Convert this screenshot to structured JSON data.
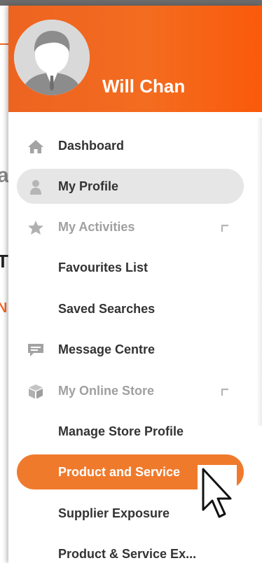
{
  "background_fragments": {
    "a": "a",
    "t": "T",
    "n": "N"
  },
  "user": {
    "name": "Will Chan"
  },
  "menu": {
    "items": [
      {
        "label": "Dashboard",
        "icon": "home-icon"
      },
      {
        "label": "My Profile",
        "icon": "person-icon"
      },
      {
        "label": "My Activities",
        "icon": "star-icon"
      },
      {
        "label": "Favourites List"
      },
      {
        "label": "Saved Searches"
      },
      {
        "label": "Message Centre",
        "icon": "message-icon"
      },
      {
        "label": "My Online Store",
        "icon": "box-icon"
      },
      {
        "label": "Manage Store Profile"
      },
      {
        "label": "Product and Service"
      },
      {
        "label": "Supplier Exposure"
      },
      {
        "label": "Product & Service Ex..."
      }
    ]
  },
  "colors": {
    "brand": "#f26a2a",
    "active_item": "#f07a2c",
    "selected_item": "#e6e6e6"
  }
}
